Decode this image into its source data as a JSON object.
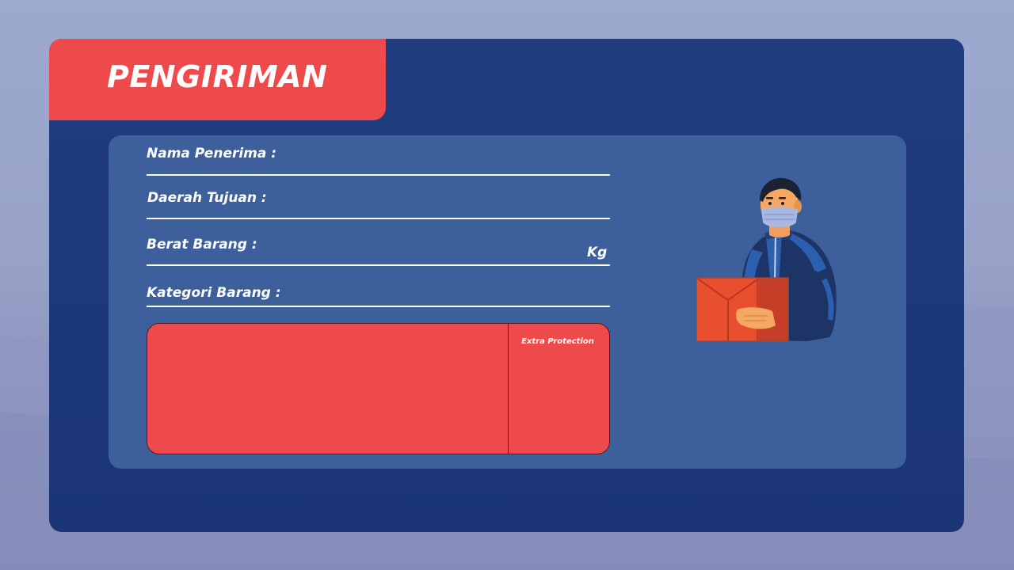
{
  "header": {
    "title": "PENGIRIMAN"
  },
  "form": {
    "recipient_label": "Nama Penerima :",
    "destination_label": "Daerah Tujuan :",
    "weight_label": "Berat Barang :",
    "weight_unit": "Kg",
    "category_label": "Kategori Barang :"
  },
  "category": {
    "extra_protection_label": "Extra Protection"
  },
  "illustration": {
    "icon": "delivery-courier-icon"
  },
  "colors": {
    "accent_red": "#ef4a4b",
    "card_navy": "#1e3a7c",
    "panel_blue": "#3d5f9b"
  }
}
